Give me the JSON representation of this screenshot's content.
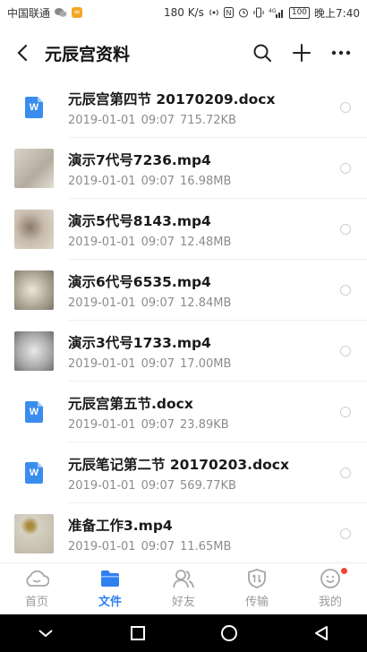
{
  "status_bar": {
    "carrier": "中国联通",
    "speed": "180 K/s",
    "signal": "4G",
    "battery": "100",
    "time": "晚上7:40"
  },
  "header": {
    "title": "元辰宫资料"
  },
  "files": [
    {
      "type": "doc",
      "name": "元辰宫第四节 20170209.docx",
      "date": "2019-01-01",
      "time": "09:07",
      "size": "715.72KB",
      "icon_label": "W"
    },
    {
      "type": "video",
      "name": "演示7代号7236.mp4",
      "date": "2019-01-01",
      "time": "09:07",
      "size": "16.98MB",
      "thumb_color": "#cfc7bd"
    },
    {
      "type": "video",
      "name": "演示5代号8143.mp4",
      "date": "2019-01-01",
      "time": "09:07",
      "size": "12.48MB",
      "thumb_color": "#b8a99a"
    },
    {
      "type": "video",
      "name": "演示6代号6535.mp4",
      "date": "2019-01-01",
      "time": "09:07",
      "size": "12.84MB",
      "thumb_color": "#a9a49c"
    },
    {
      "type": "video",
      "name": "演示3代号1733.mp4",
      "date": "2019-01-01",
      "time": "09:07",
      "size": "17.00MB",
      "thumb_color": "#bcbcbc"
    },
    {
      "type": "doc",
      "name": "元辰宫第五节.docx",
      "date": "2019-01-01",
      "time": "09:07",
      "size": "23.89KB",
      "icon_label": "W"
    },
    {
      "type": "doc",
      "name": "元辰笔记第二节 20170203.docx",
      "date": "2019-01-01",
      "time": "09:07",
      "size": "569.77KB",
      "icon_label": "W"
    },
    {
      "type": "video",
      "name": "准备工作3.mp4",
      "date": "2019-01-01",
      "time": "09:07",
      "size": "11.65MB",
      "thumb_color": "#c8c3b6"
    }
  ],
  "bottom_nav": [
    {
      "label": "首页",
      "icon": "cloud-icon",
      "active": false
    },
    {
      "label": "文件",
      "icon": "folder-icon",
      "active": true
    },
    {
      "label": "好友",
      "icon": "friends-icon",
      "active": false
    },
    {
      "label": "传输",
      "icon": "transfer-icon",
      "active": false
    },
    {
      "label": "我的",
      "icon": "profile-icon",
      "active": false
    }
  ],
  "colors": {
    "accent": "#2f7ff0",
    "doc_icon": "#3a8dee",
    "badge": "#f44336"
  }
}
